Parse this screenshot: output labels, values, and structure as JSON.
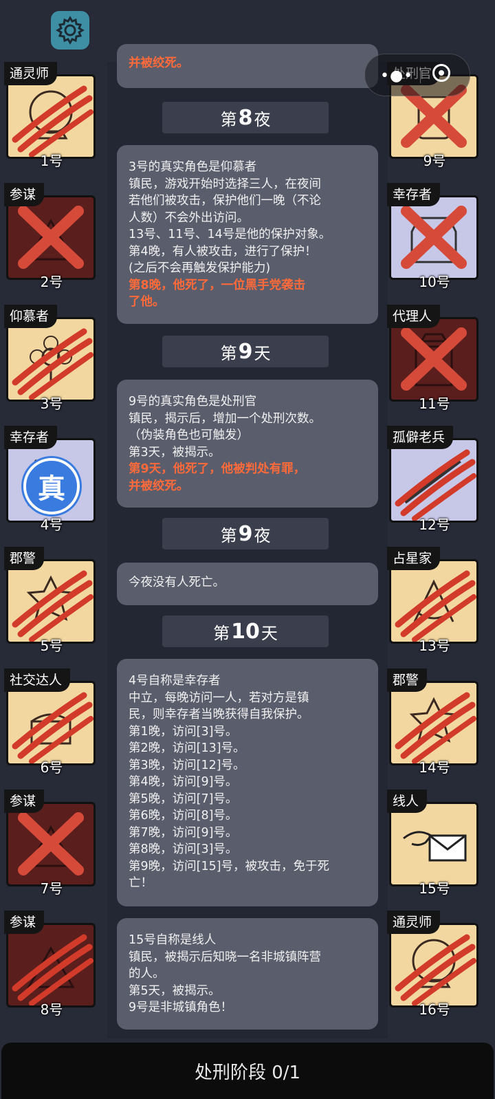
{
  "header": {
    "settings_icon": "gear-icon"
  },
  "log": {
    "top_fragment": "并被绞死。",
    "headers": [
      {
        "prefix": "第",
        "num": "8",
        "suffix": "夜"
      },
      {
        "prefix": "第",
        "num": "9",
        "suffix": "天"
      },
      {
        "prefix": "第",
        "num": "9",
        "suffix": "夜"
      },
      {
        "prefix": "第",
        "num": "10",
        "suffix": "天"
      }
    ],
    "msg1": {
      "lines": [
        "3号的真实角色是仰慕者",
        "镇民，游戏开始时选择三人，在夜间",
        "若他们被攻击，保护他们一晚（不论",
        "人数）不会外出访问。",
        "13号、11号、14号是他的保护对象。",
        "第4晚，有人被攻击，进行了保护！",
        "(之后不会再触发保护能力)"
      ],
      "red": [
        "第8晚，他死了，一位黑手党袭击",
        "了他。"
      ]
    },
    "msg2": {
      "lines": [
        "9号的真实角色是处刑官",
        "镇民，揭示后，增加一个处刑次数。",
        "（伪装角色也可触发）",
        "第3天，被揭示。"
      ],
      "red": [
        "第9天，他死了，他被判处有罪，",
        "并被绞死。"
      ]
    },
    "msg3": {
      "lines": [
        "今夜没有人死亡。"
      ],
      "red": []
    },
    "msg4": {
      "lines": [
        "4号自称是幸存者",
        "中立，每晚访问一人，若对方是镇",
        "民，则幸存者当晚获得自我保护。",
        "第1晚，访问[3]号。",
        "第2晚，访问[13]号。",
        "第3晚，访问[12]号。",
        "第4晚，访问[9]号。",
        "第5晚，访问[7]号。",
        "第6晚，访问[8]号。",
        "第7晚，访问[9]号。",
        "第8晚，访问[3]号。",
        "第9晚，访问[15]号，被攻击，免于死",
        "亡！"
      ],
      "red": []
    },
    "msg5": {
      "lines": [
        "15号自称是线人",
        "镇民，被揭示后知晓一名非城镇阵营",
        "的人。",
        "第5天，被揭示。",
        "9号是非城镇角色！"
      ],
      "red": []
    }
  },
  "players_left": [
    {
      "role": "通灵师",
      "num": "1号",
      "icon": "crystal-ball-icon",
      "bg": "#f3d7a0",
      "mark": "claw"
    },
    {
      "role": "参谋",
      "num": "2号",
      "icon": "pyramid-icon",
      "bg": "#5a1e1d",
      "mark": "cross"
    },
    {
      "role": "仰慕者",
      "num": "3号",
      "icon": "flower-icon",
      "bg": "#f3d7a0",
      "mark": "claw"
    },
    {
      "role": "幸存者",
      "num": "4号",
      "icon": "vest-icon",
      "bg": "#c7c8e8",
      "mark": "stamp",
      "stamp": "真"
    },
    {
      "role": "郡警",
      "num": "5号",
      "icon": "sheriff-badge-icon",
      "bg": "#f3d7a0",
      "mark": "claw"
    },
    {
      "role": "社交达人",
      "num": "6号",
      "icon": "cake-icon",
      "bg": "#f3d7a0",
      "mark": "claw"
    },
    {
      "role": "参谋",
      "num": "7号",
      "icon": "pyramid-icon",
      "bg": "#5a1e1d",
      "mark": "cross"
    },
    {
      "role": "参谋",
      "num": "8号",
      "icon": "pyramid-icon",
      "bg": "#5a1e1d",
      "mark": "claw"
    }
  ],
  "players_right": [
    {
      "role": "处刑官",
      "num": "9号",
      "icon": "scroll-icon",
      "bg": "#f3d7a0",
      "mark": "cross"
    },
    {
      "role": "幸存者",
      "num": "10号",
      "icon": "vest-icon",
      "bg": "#c7c8e8",
      "mark": "cross"
    },
    {
      "role": "代理人",
      "num": "11号",
      "icon": "trench-coat-icon",
      "bg": "#5a1e1d",
      "mark": "cross"
    },
    {
      "role": "孤僻老兵",
      "num": "12号",
      "icon": "rifle-icon",
      "bg": "#c7c8e8",
      "mark": "claw"
    },
    {
      "role": "占星家",
      "num": "13号",
      "icon": "sextant-icon",
      "bg": "#f3d7a0",
      "mark": "claw"
    },
    {
      "role": "郡警",
      "num": "14号",
      "icon": "sheriff-badge-icon",
      "bg": "#f3d7a0",
      "mark": "claw"
    },
    {
      "role": "线人",
      "num": "15号",
      "icon": "envelope-icon",
      "bg": "#f3d7a0",
      "mark": "none"
    },
    {
      "role": "通灵师",
      "num": "16号",
      "icon": "crystal-ball-icon",
      "bg": "#f3d7a0",
      "mark": "claw"
    }
  ],
  "footer": {
    "phase_label": "处刑阶段 0/1"
  },
  "capsule": {
    "more_icon": "more-dots-icon",
    "close_icon": "close-target-icon"
  },
  "colors": {
    "red_text": "#ff6a3a",
    "claw": "#d23a2a",
    "cross": "#d64a3a"
  }
}
